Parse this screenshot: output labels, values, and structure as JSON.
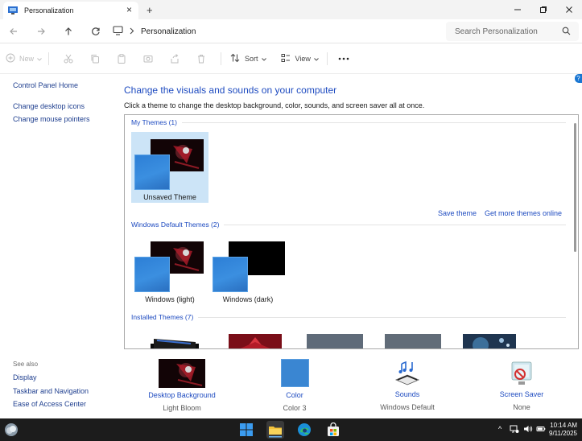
{
  "window": {
    "tab_title": "Personalization",
    "new_tab_glyph": "+",
    "close_tab_glyph": "×"
  },
  "address": {
    "crumb": "Personalization",
    "search_placeholder": "Search Personalization"
  },
  "commands": {
    "new_label": "New",
    "sort_label": "Sort",
    "view_label": "View"
  },
  "sidebar": {
    "home": "Control Panel Home",
    "links": [
      "Change desktop icons",
      "Change mouse pointers"
    ],
    "see_also_title": "See also",
    "see_also": [
      "Display",
      "Taskbar and Navigation",
      "Ease of Access Center"
    ]
  },
  "main": {
    "title": "Change the visuals and sounds on your computer",
    "subtitle": "Click a theme to change the desktop background, color, sounds, and screen saver all at once.",
    "groups": {
      "my_themes": "My Themes (1)",
      "default_themes": "Windows Default Themes (2)",
      "installed_themes": "Installed Themes (7)"
    },
    "themes": {
      "unsaved": "Unsaved Theme",
      "light": "Windows (light)",
      "dark": "Windows (dark)"
    },
    "save_theme": "Save theme",
    "get_more": "Get more themes online"
  },
  "settings_row": [
    {
      "label": "Desktop Background",
      "value": "Light Bloom"
    },
    {
      "label": "Color",
      "value": "Color 3"
    },
    {
      "label": "Sounds",
      "value": "Windows Default"
    },
    {
      "label": "Screen Saver",
      "value": "None"
    }
  ],
  "taskbar": {
    "time": "10:14 AM",
    "date": "9/11/2025",
    "tray_chevron": "^"
  },
  "help_glyph": "?",
  "colors": {
    "accent": "#1e4bc0",
    "selection": "#cce4f7",
    "taskbar": "#1c1c1c"
  },
  "icons": [
    "control-panel-icon",
    "back-icon",
    "forward-icon",
    "up-icon",
    "refresh-icon",
    "monitor-icon",
    "search-icon",
    "new-icon",
    "cut-icon",
    "copy-icon",
    "paste-icon",
    "rename-icon",
    "share-icon",
    "delete-icon",
    "sort-icon",
    "view-icon",
    "more-icon",
    "windows-start-icon",
    "file-explorer-icon",
    "edge-icon",
    "store-icon",
    "widgets-icon"
  ]
}
